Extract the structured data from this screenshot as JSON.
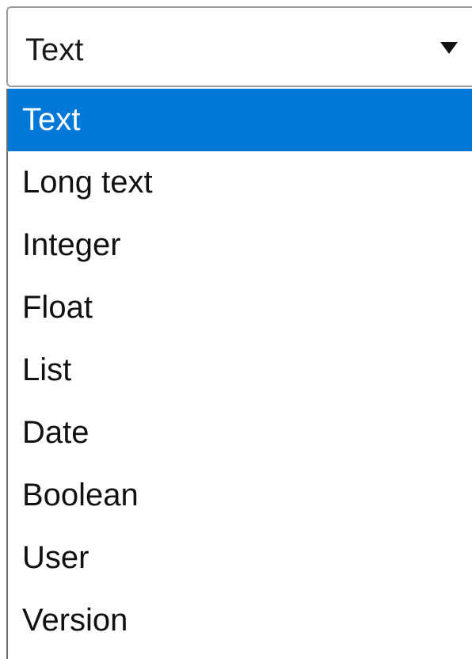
{
  "select": {
    "value": "Text",
    "caret_icon": "triangle-down-icon"
  },
  "options": [
    {
      "label": "Text",
      "selected": true
    },
    {
      "label": "Long text",
      "selected": false
    },
    {
      "label": "Integer",
      "selected": false
    },
    {
      "label": "Float",
      "selected": false
    },
    {
      "label": "List",
      "selected": false
    },
    {
      "label": "Date",
      "selected": false
    },
    {
      "label": "Boolean",
      "selected": false
    },
    {
      "label": "User",
      "selected": false
    },
    {
      "label": "Version",
      "selected": false
    }
  ],
  "colors": {
    "highlight": "#0078d7",
    "highlight_text": "#ffffff",
    "text": "#111111",
    "border": "#9a9a9a"
  }
}
